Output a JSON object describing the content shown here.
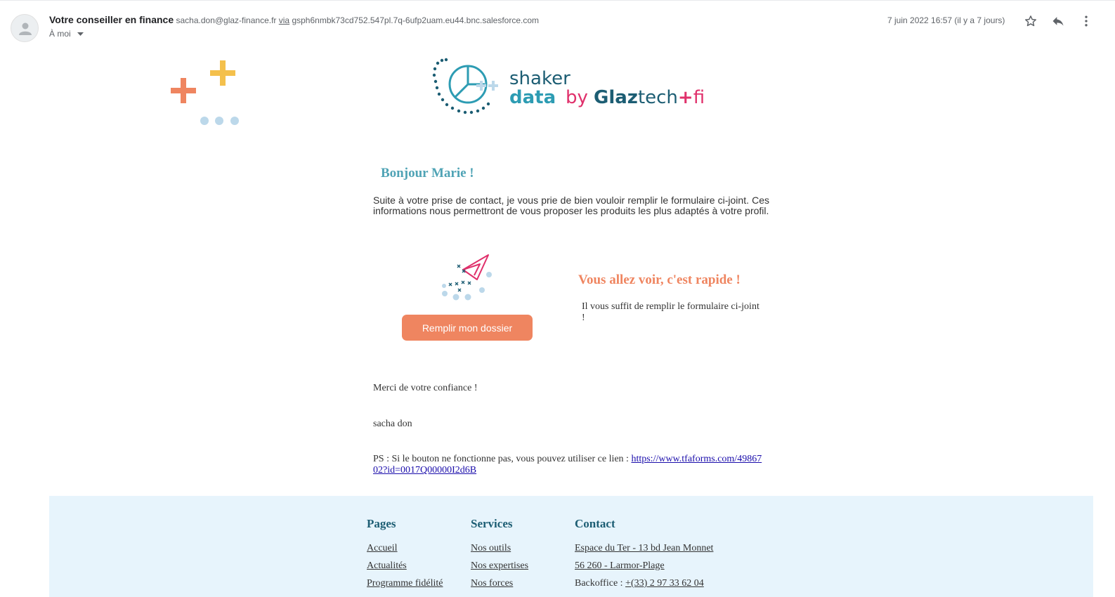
{
  "header": {
    "sender_name": "Votre conseiller en finance",
    "sender_email": "sacha.don@glaz-finance.fr",
    "via_label": "via",
    "via_domain": "gsph6nmbk73cd752.547pl.7q-6ufp2uam.eu44.bnc.salesforce.com",
    "recipient": "À moi",
    "date": "7 juin 2022 16:57 (il y a 7 jours)",
    "icons": [
      "avatar-icon",
      "star-icon",
      "reply-icon",
      "more-options-icon"
    ]
  },
  "logo": {
    "word1": "shaker",
    "word2": "data",
    "by": "by",
    "brand_bold": "Glaz",
    "brand_rest": "tech",
    "brand_plus": "+",
    "brand_end": "fi"
  },
  "body": {
    "greeting": "Bonjour Marie !",
    "intro": "Suite à votre prise de contact, je vous prie de bien vouloir remplir le formulaire ci-joint. Ces informations nous permettront de vous proposer les produits les plus adaptés à votre profil.",
    "cta_label": "Remplir mon dossier",
    "fast_title": "Vous allez voir, c'est rapide !",
    "fast_text": "Il vous suffit de remplir le formulaire ci-joint !",
    "thanks": "Merci de votre confiance !",
    "signature": "sacha don",
    "ps_text": "PS : Si le bouton ne fonctionne pas, vous pouvez utiliser ce lien : ",
    "ps_link": "https://www.tfaforms.com/4986702?id=0017Q00000I2d6B"
  },
  "footer": {
    "pages": {
      "title": "Pages",
      "links": [
        "Accueil",
        "Actualités",
        "Programme fidélité"
      ]
    },
    "services": {
      "title": "Services",
      "links": [
        "Nos outils",
        "Nos expertises",
        "Nos forces"
      ]
    },
    "contact": {
      "title": "Contact",
      "address1": "Espace du Ter - 13 bd Jean Monnet",
      "address2": "56 260 - Larmor-Plage",
      "backoffice_label": "Backoffice : ",
      "backoffice_phone": "+(33) 2 97 33 62 04"
    }
  },
  "colors": {
    "teal": "#4fa3b5",
    "dark_teal": "#1c5d73",
    "orange": "#ef8560",
    "yellow": "#f4c04c",
    "pink": "#e0306b",
    "footer_bg": "#e7f4fc"
  }
}
